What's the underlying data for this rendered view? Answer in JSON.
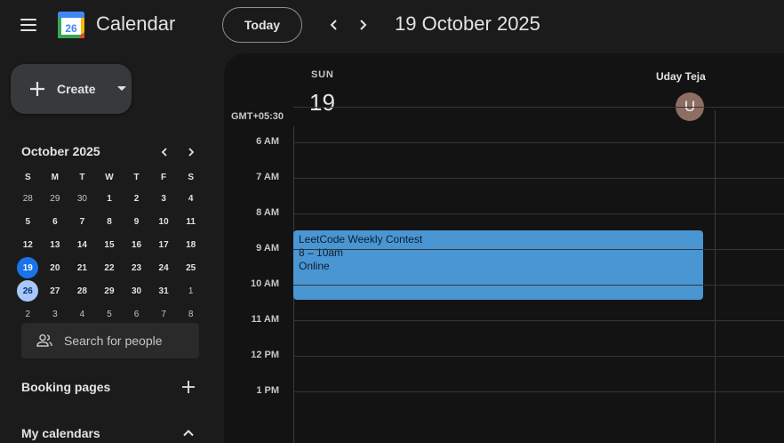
{
  "header": {
    "app_title": "Calendar",
    "logo_number": "26",
    "today_label": "Today",
    "date_title": "19 October 2025"
  },
  "sidebar": {
    "create_label": "Create",
    "mini_calendar": {
      "month_label": "October 2025",
      "weekdays": [
        "S",
        "M",
        "T",
        "W",
        "T",
        "F",
        "S"
      ],
      "weeks": [
        [
          "28",
          "29",
          "30",
          "1",
          "2",
          "3",
          "4"
        ],
        [
          "5",
          "6",
          "7",
          "8",
          "9",
          "10",
          "11"
        ],
        [
          "12",
          "13",
          "14",
          "15",
          "16",
          "17",
          "18"
        ],
        [
          "19",
          "20",
          "21",
          "22",
          "23",
          "24",
          "25"
        ],
        [
          "26",
          "27",
          "28",
          "29",
          "30",
          "31",
          "1"
        ],
        [
          "2",
          "3",
          "4",
          "5",
          "6",
          "7",
          "8"
        ]
      ],
      "today": "19",
      "selected": "26"
    },
    "search_people_placeholder": "Search for people",
    "booking_pages_label": "Booking pages",
    "my_calendars_label": "My calendars"
  },
  "day_view": {
    "day_name": "SUN",
    "day_number": "19",
    "person_name": "Uday Teja",
    "avatar_initial": "U",
    "timezone_label": "GMT+05:30",
    "hours": [
      "6 AM",
      "7 AM",
      "8 AM",
      "9 AM",
      "10 AM",
      "11 AM",
      "12 PM",
      "1 PM"
    ],
    "events": [
      {
        "title": "LeetCode Weekly Contest",
        "time": "8 – 10am",
        "location": "Online",
        "color": "#4a96d3"
      }
    ]
  },
  "colors": {
    "background": "#1b1b1b",
    "panel": "#131314",
    "today_circle": "#1a73e8",
    "selected_circle": "#a8c7fa",
    "avatar": "#8d6e63"
  }
}
